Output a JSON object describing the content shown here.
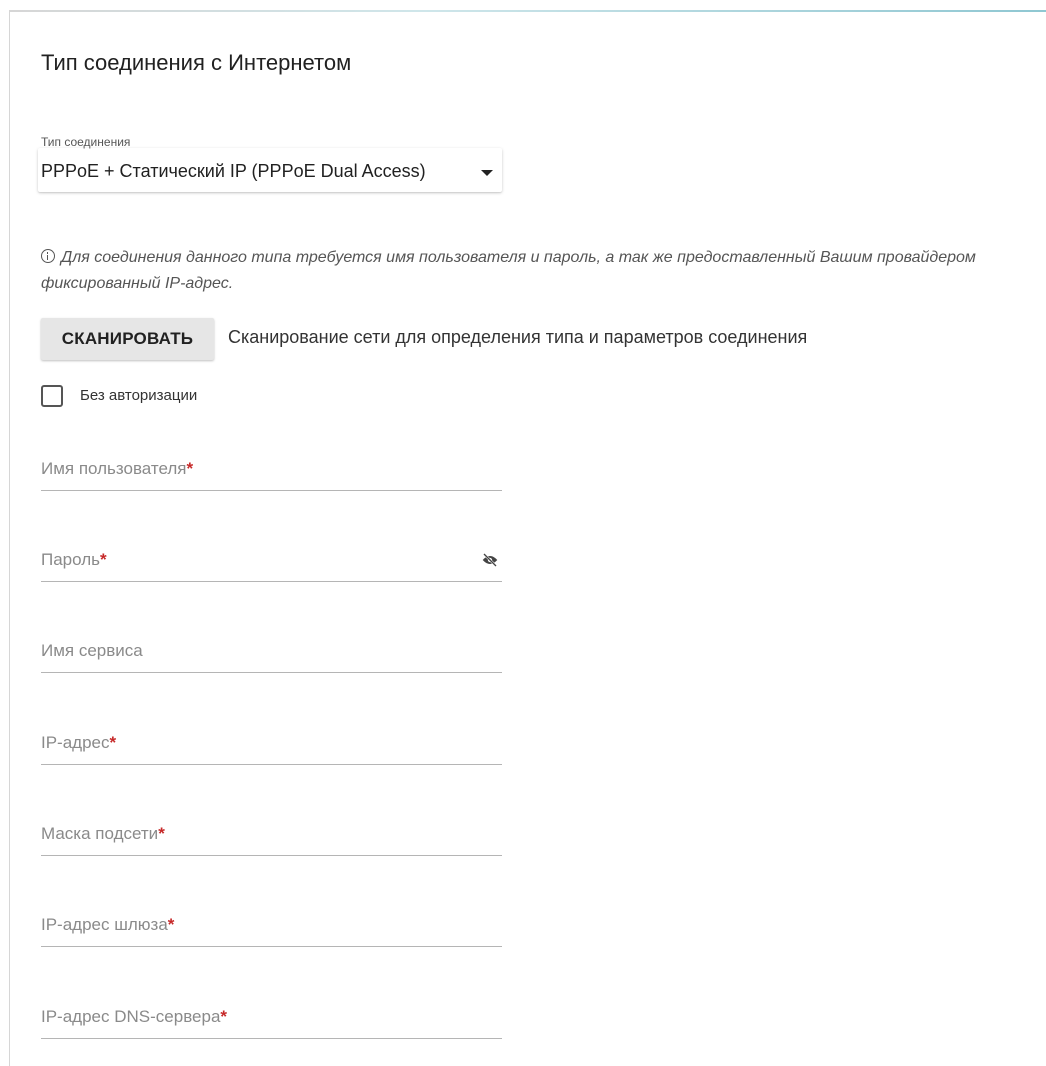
{
  "page": {
    "title": "Тип соединения с Интернетом"
  },
  "connection_type": {
    "label": "Тип соединения",
    "value": "PPPoE + Статический IP (PPPoE Dual Access)"
  },
  "info": {
    "text": "Для соединения данного типа требуется имя пользователя и пароль, а так же предоставленный Вашим провайдером фиксированный IP-адрес."
  },
  "scan": {
    "button_label": "СКАНИРОВАТЬ",
    "description": "Сканирование сети для определения типа и параметров соединения"
  },
  "no_auth": {
    "label": "Без авторизации",
    "checked": false
  },
  "fields": {
    "username": {
      "label": "Имя пользователя",
      "required": "*"
    },
    "password": {
      "label": "Пароль",
      "required": "*"
    },
    "service_name": {
      "label": "Имя сервиса"
    },
    "ip_address": {
      "label": "IP-адрес",
      "required": "*"
    },
    "subnet_mask": {
      "label": "Маска подсети",
      "required": "*"
    },
    "gateway": {
      "label": "IP-адрес шлюза",
      "required": "*"
    },
    "dns": {
      "label": "IP-адрес DNS-сервера",
      "required": "*"
    }
  },
  "colors": {
    "required_marker": "#c62828",
    "button_background": "#e6e6e6",
    "field_line": "#b5b5b5"
  },
  "icons": {
    "info": "info-icon",
    "password_toggle": "eye-off-icon",
    "dropdown": "caret-down-icon"
  }
}
